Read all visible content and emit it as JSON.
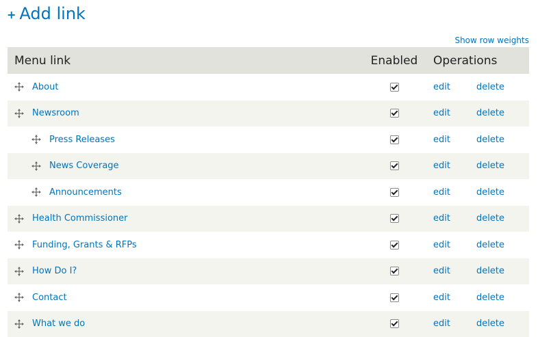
{
  "add_link": {
    "icon": "plus-icon",
    "label": "Add link"
  },
  "show_row_weights": "Show row weights",
  "table": {
    "headers": {
      "link": "Menu link",
      "enabled": "Enabled",
      "operations": "Operations"
    },
    "rows": [
      {
        "label": "About",
        "level": 0,
        "enabled": true,
        "edit": "edit",
        "delete": "delete"
      },
      {
        "label": "Newsroom",
        "level": 0,
        "enabled": true,
        "edit": "edit",
        "delete": "delete"
      },
      {
        "label": "Press Releases",
        "level": 1,
        "enabled": true,
        "edit": "edit",
        "delete": "delete"
      },
      {
        "label": "News Coverage",
        "level": 1,
        "enabled": true,
        "edit": "edit",
        "delete": "delete"
      },
      {
        "label": "Announcements",
        "level": 1,
        "enabled": true,
        "edit": "edit",
        "delete": "delete"
      },
      {
        "label": "Health Commissioner",
        "level": 0,
        "enabled": true,
        "edit": "edit",
        "delete": "delete"
      },
      {
        "label": "Funding, Grants & RFPs",
        "level": 0,
        "enabled": true,
        "edit": "edit",
        "delete": "delete"
      },
      {
        "label": "How Do I?",
        "level": 0,
        "enabled": true,
        "edit": "edit",
        "delete": "delete"
      },
      {
        "label": "Contact",
        "level": 0,
        "enabled": true,
        "edit": "edit",
        "delete": "delete"
      },
      {
        "label": "What we do",
        "level": 0,
        "enabled": true,
        "edit": "edit",
        "delete": "delete"
      }
    ]
  },
  "colors": {
    "link": "#0074bd",
    "header_bg": "#e1e2dc",
    "zebra_bg": "#f3f4ee"
  }
}
